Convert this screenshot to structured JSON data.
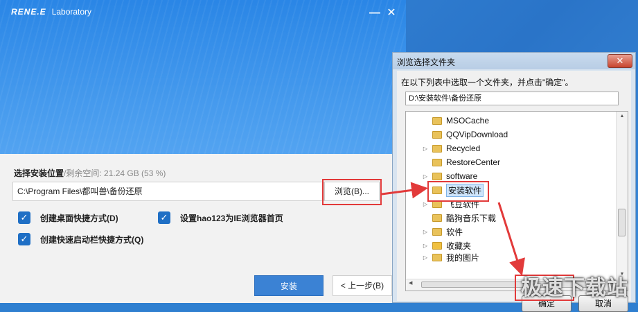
{
  "installer": {
    "brand_logo": "RENE.E",
    "brand_name": "Laboratory",
    "minimize_label": "—",
    "close_label": "✕",
    "install_location_label": "选择安装位置",
    "free_space_label": "/剩余空间: 21.24 GB (53 %)",
    "install_path": "C:\\Program Files\\都叫兽\\备份还原",
    "browse_button": "浏览(B)...",
    "options": [
      {
        "label": "创建桌面快捷方式(D)",
        "checked": true
      },
      {
        "label": "设置hao123为IE浏览器首页",
        "checked": true
      },
      {
        "label": "创建快速启动栏快捷方式(Q)",
        "checked": true
      }
    ],
    "install_button": "安装",
    "prev_button": "< 上一步(B)"
  },
  "dialog": {
    "title": "浏览选择文件夹",
    "close_label": "✕",
    "prompt": "在以下列表中选取一个文件夹，并点击\"确定\"。",
    "current_path": "D:\\安装软件\\备份还原",
    "tree": [
      {
        "label": "MSOCache",
        "expandable": false,
        "selected": false
      },
      {
        "label": "QQVipDownload",
        "expandable": false,
        "selected": false
      },
      {
        "label": "Recycled",
        "expandable": true,
        "selected": false
      },
      {
        "label": "RestoreCenter",
        "expandable": false,
        "selected": false
      },
      {
        "label": "software",
        "expandable": true,
        "selected": false
      },
      {
        "label": "安装软件",
        "expandable": false,
        "selected": true
      },
      {
        "label": "飞豆软件",
        "expandable": true,
        "selected": false
      },
      {
        "label": "酷狗音乐下载",
        "expandable": false,
        "selected": false
      },
      {
        "label": "软件",
        "expandable": true,
        "selected": false
      },
      {
        "label": "收藏夹",
        "expandable": true,
        "selected": false
      },
      {
        "label": "我的图片",
        "expandable": true,
        "selected": false
      }
    ],
    "ok_button": "确定",
    "cancel_button": "取消"
  },
  "watermark": "极速下载站",
  "colors": {
    "accent": "#2a86e6",
    "highlight": "#e23a3a",
    "button_blue": "#3b82d4"
  }
}
